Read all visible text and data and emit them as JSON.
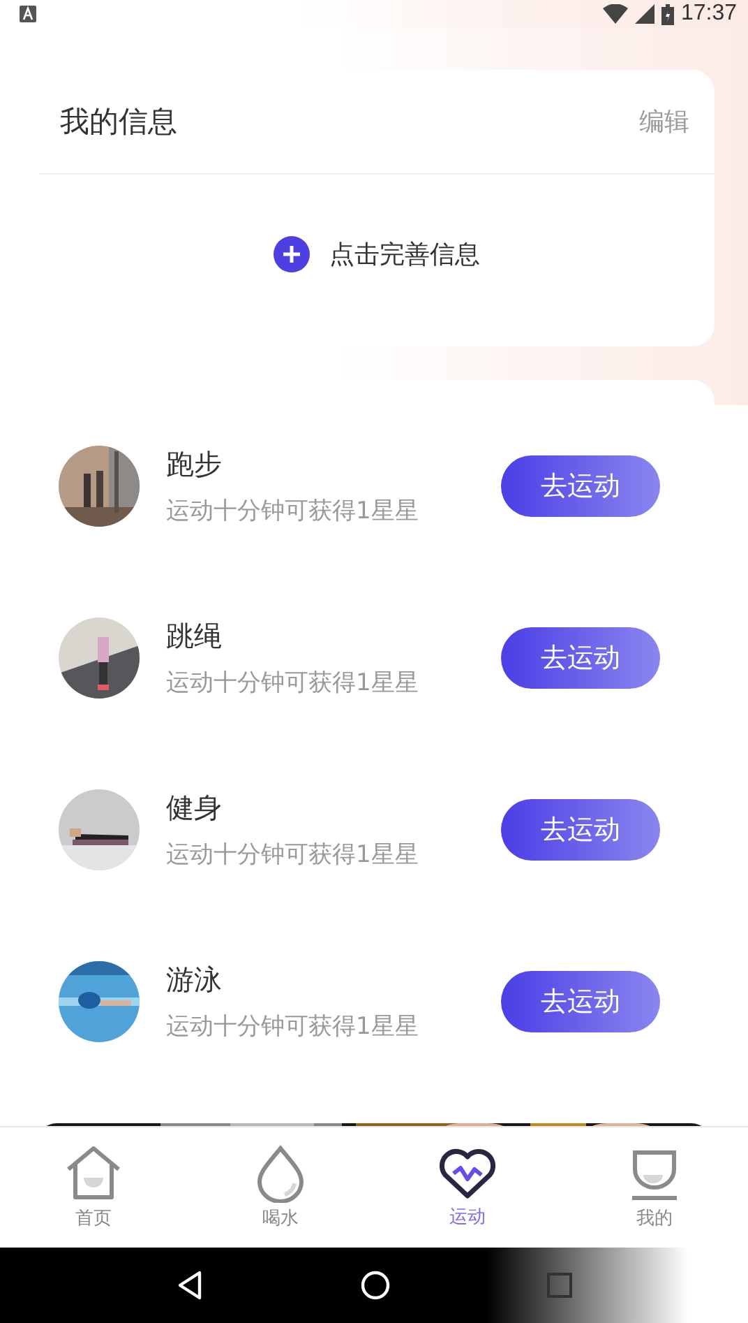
{
  "status_bar": {
    "time": "17:37"
  },
  "profile_card": {
    "title": "我的信息",
    "edit": "编辑",
    "add_label": "点击完善信息"
  },
  "activities": [
    {
      "name": "跑步",
      "hint": "运动十分钟可获得1星星",
      "button": "去运动"
    },
    {
      "name": "跳绳",
      "hint": "运动十分钟可获得1星星",
      "button": "去运动"
    },
    {
      "name": "健身",
      "hint": "运动十分钟可获得1星星",
      "button": "去运动"
    },
    {
      "name": "游泳",
      "hint": "运动十分钟可获得1星星",
      "button": "去运动"
    }
  ],
  "tabs": [
    {
      "label": "首页",
      "selected": false
    },
    {
      "label": "喝水",
      "selected": false
    },
    {
      "label": "运动",
      "selected": true
    },
    {
      "label": "我的",
      "selected": false
    }
  ]
}
